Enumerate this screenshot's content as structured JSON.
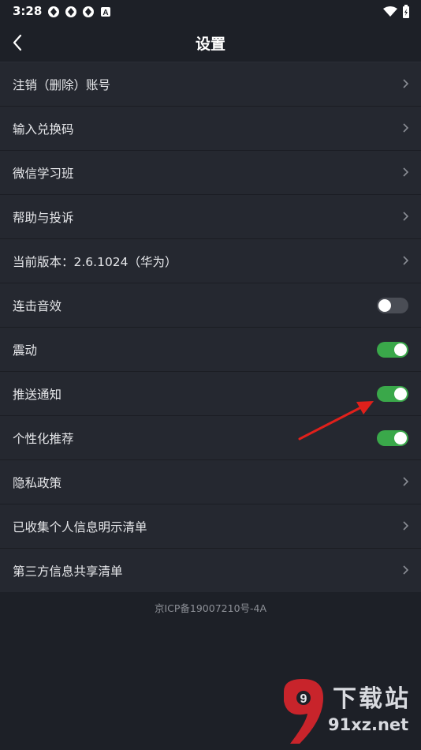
{
  "status_bar": {
    "time": "3:28",
    "notif_badge": "A"
  },
  "header": {
    "title": "设置"
  },
  "rows": [
    {
      "label": "注销（删除）账号",
      "control": "chevron"
    },
    {
      "label": "输入兑换码",
      "control": "chevron"
    },
    {
      "label": "微信学习班",
      "control": "chevron"
    },
    {
      "label": "帮助与投诉",
      "control": "chevron"
    },
    {
      "label": "当前版本：2.6.1024（华为）",
      "control": "chevron"
    },
    {
      "label": "连击音效",
      "control": "toggle",
      "on": false
    },
    {
      "label": "震动",
      "control": "toggle",
      "on": true
    },
    {
      "label": "推送通知",
      "control": "toggle",
      "on": true
    },
    {
      "label": "个性化推荐",
      "control": "toggle",
      "on": true
    },
    {
      "label": "隐私政策",
      "control": "chevron"
    },
    {
      "label": "已收集个人信息明示清单",
      "control": "chevron"
    },
    {
      "label": "第三方信息共享清单",
      "control": "chevron"
    }
  ],
  "footer": {
    "icp": "京ICP备19007210号-4A"
  },
  "watermark": {
    "brand": "下载站",
    "domain": "91xz.net",
    "logo_text": "9"
  },
  "colors": {
    "background": "#1d2027",
    "row_bg": "#252830",
    "toggle_on": "#3aa84a",
    "toggle_off": "#4a4d55",
    "annotation_arrow": "#e0201b"
  }
}
